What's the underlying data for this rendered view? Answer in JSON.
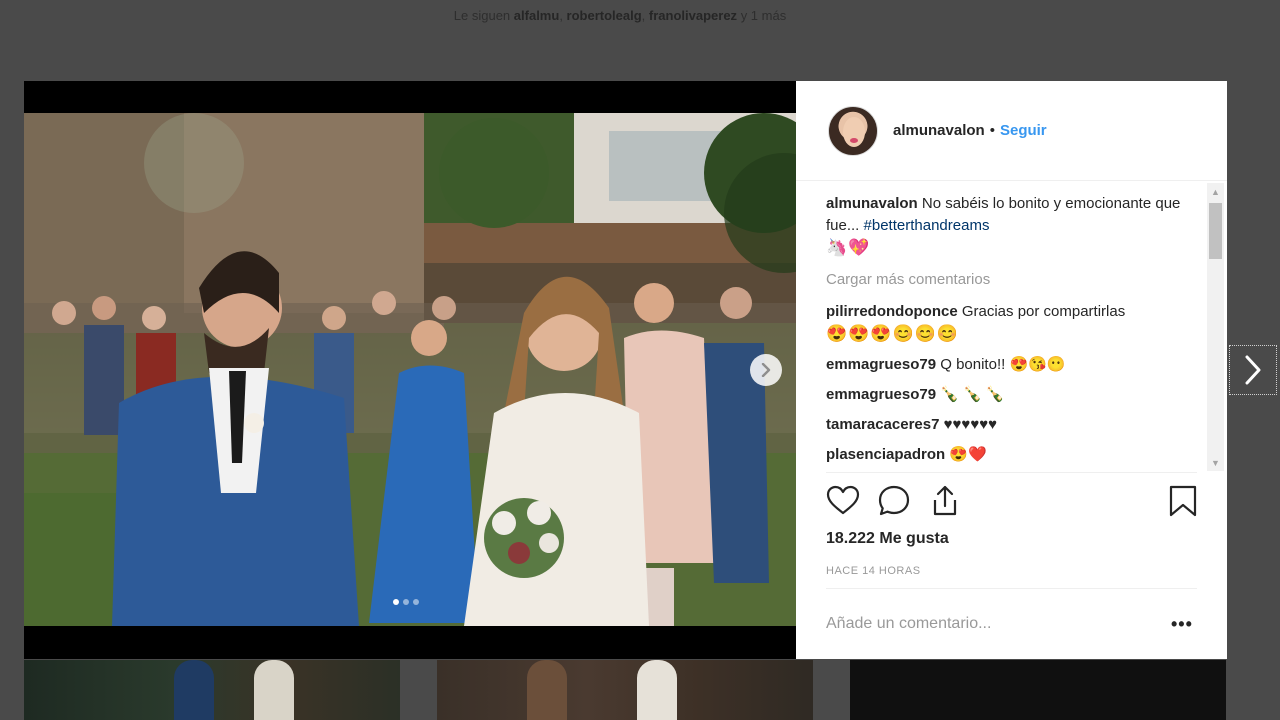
{
  "background": {
    "followers_prefix": "Le siguen",
    "followers": [
      "alfalmu",
      "robertolealg",
      "franolivaperez"
    ],
    "followers_suffix": "y 1 más"
  },
  "post": {
    "username": "almunavalon",
    "separator": "•",
    "follow_label": "Seguir",
    "caption_user": "almunavalon",
    "caption_text": "No sabéis lo bonito y emocionante que fue...",
    "caption_hashtag": "#betterthandreams",
    "caption_emojis": "🦄💖",
    "load_more": "Cargar más comentarios",
    "comments": [
      {
        "user": "pilirredondoponce",
        "text": "Gracias por compartirlas",
        "emojis": "😍😍😍😊😊😊"
      },
      {
        "user": "emmagrueso79",
        "text": "Q bonito!! 😍😘😶",
        "emojis": ""
      },
      {
        "user": "emmagrueso79",
        "text": "🍾 🍾 🍾",
        "emojis": ""
      },
      {
        "user": "tamaracaceres7",
        "text": "♥♥♥♥♥♥",
        "emojis": ""
      },
      {
        "user": "plasenciapadron",
        "text": "😍❤️",
        "emojis": ""
      }
    ],
    "likes": "18.222 Me gusta",
    "time": "HACE 14 HORAS",
    "add_comment_placeholder": "Añade un comentario...",
    "more_label": "•••",
    "carousel_dots": 3,
    "carousel_active": 1
  },
  "icons": {
    "like": "heart-icon",
    "comment": "comment-bubble-icon",
    "share": "share-icon",
    "save": "bookmark-icon",
    "next": "chevron-right-icon"
  },
  "colors": {
    "accent": "#3897f0",
    "hashtag": "#003569",
    "text": "#262626",
    "muted": "#999999"
  }
}
